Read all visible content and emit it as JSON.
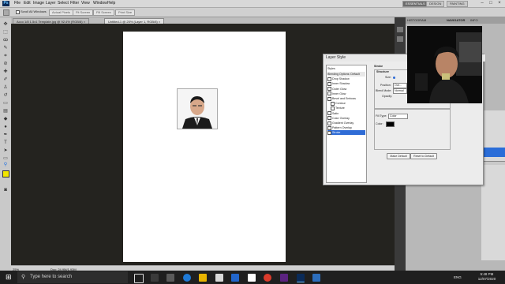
{
  "menubar": {
    "app_icon": "Ps",
    "menus": [
      "File",
      "Edit",
      "Image",
      "Layer",
      "Select",
      "Filter",
      "View",
      "Window",
      "Help"
    ],
    "workspace_buttons": [
      "ESSENTIALS",
      "DESIGN",
      "PAINTING"
    ]
  },
  "optionsbar": {
    "scroll_all": "Scroll All Windows",
    "buttons": [
      "Actual Pixels",
      "Fit Screen",
      "Fill Screen",
      "Print Size"
    ]
  },
  "tabs": [
    {
      "label": "Acco 1/8 1.5x1 Template.jpg @ 92.4% (RGB/8) ×"
    },
    {
      "label": "Untitled-1 @ 25% (Layer 1, RGB/8) ×"
    }
  ],
  "status": {
    "zoom": "25%",
    "doc": "Doc: 24.9M/1.93M"
  },
  "right_panel_tabs": [
    "HISTOGRAM",
    "NAVIGATOR",
    "INFO"
  ],
  "dialog": {
    "title": "Layer Style",
    "list_header": "Styles",
    "list_items": [
      {
        "label": "Blending Options: Default",
        "checkbox": false,
        "selected": false,
        "header": true
      },
      {
        "label": "Drop Shadow",
        "checkbox": true,
        "selected": false,
        "header": false
      },
      {
        "label": "Inner Shadow",
        "checkbox": true,
        "selected": false,
        "header": false
      },
      {
        "label": "Outer Glow",
        "checkbox": true,
        "selected": false,
        "header": false
      },
      {
        "label": "Inner Glow",
        "checkbox": true,
        "selected": false,
        "header": false
      },
      {
        "label": "Bevel and Emboss",
        "checkbox": true,
        "selected": false,
        "header": false
      },
      {
        "label": "Contour",
        "checkbox": true,
        "selected": false,
        "header": false,
        "indent": true
      },
      {
        "label": "Texture",
        "checkbox": true,
        "selected": false,
        "header": false,
        "indent": true
      },
      {
        "label": "Satin",
        "checkbox": true,
        "selected": false,
        "header": false
      },
      {
        "label": "Color Overlay",
        "checkbox": true,
        "selected": false,
        "header": false
      },
      {
        "label": "Gradient Overlay",
        "checkbox": true,
        "selected": false,
        "header": false
      },
      {
        "label": "Pattern Overlay",
        "checkbox": true,
        "selected": false,
        "header": false
      },
      {
        "label": "Stroke",
        "checkbox": true,
        "selected": true,
        "header": false
      }
    ],
    "stroke": {
      "section": "Stroke",
      "structure": "Structure",
      "size_label": "Size:",
      "position_label": "Position:",
      "position_value": "Out...",
      "blend_label": "Blend Mode:",
      "blend_value": "Normal",
      "opacity_label": "Opacity:",
      "fill_type_label": "Fill Type:",
      "fill_type_value": "Color",
      "color_label": "Color:",
      "color_value": "#000000",
      "make_default": "Make Default",
      "reset_default": "Reset to Default"
    }
  },
  "taskbar": {
    "search_placeholder": "Type here to search",
    "lang": "ENG",
    "time": "5:48 PM",
    "date": "12/07/2020"
  },
  "colors": {
    "foreground": "#f2e600",
    "background": "#ffffff",
    "selection": "#2f6cd6",
    "canvas_bg": "#24231f"
  }
}
